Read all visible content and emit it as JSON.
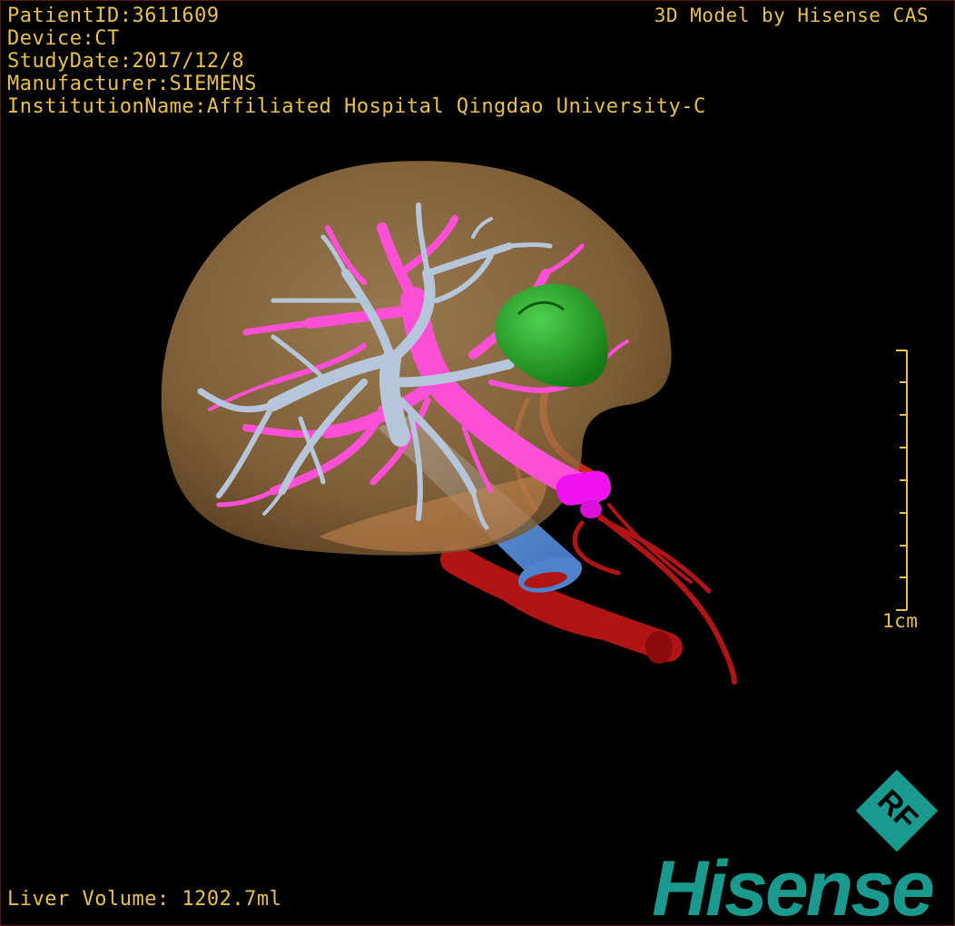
{
  "dicom_info": {
    "patient_id": "PatientID:3611609",
    "device": "Device:CT",
    "study_date": "StudyDate:2017/12/8",
    "manufacturer": "Manufacturer:SIEMENS",
    "institution": "InstitutionName:Affiliated Hospital Qingdao University-C"
  },
  "credit": "3D Model by Hisense CAS",
  "liver_volume": "Liver Volume: 1202.7ml",
  "scale": {
    "label": "1cm"
  },
  "logo": {
    "badge_text": "RF",
    "wordmark": "Hisense"
  },
  "colors": {
    "overlay_text": "#e8c04a",
    "liver": "#a07a45",
    "hepatic_vein": "#b8c8dc",
    "portal_vein": "#ff55d8",
    "tumor": "#22a922",
    "artery": "#c01818",
    "ivc": "#5a90d8",
    "brand": "#1a9a8e"
  },
  "structures": [
    "liver",
    "hepatic-vein",
    "portal-vein",
    "tumor",
    "hepatic-artery",
    "inferior-vena-cava"
  ]
}
